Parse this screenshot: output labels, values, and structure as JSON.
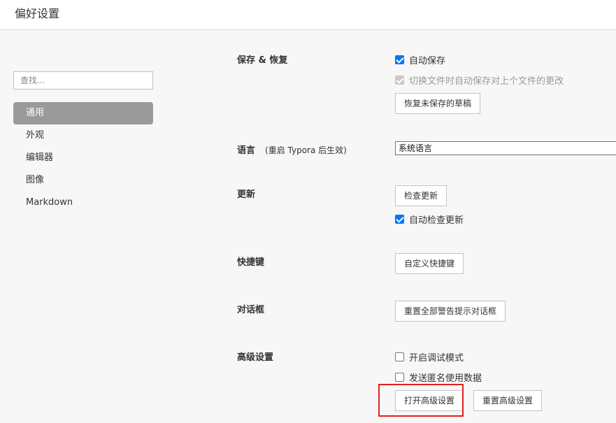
{
  "window": {
    "title": "偏好设置"
  },
  "sidebar": {
    "search_placeholder": "查找...",
    "items": [
      {
        "label": "通用",
        "active": true
      },
      {
        "label": "外观",
        "active": false
      },
      {
        "label": "编辑器",
        "active": false
      },
      {
        "label": "图像",
        "active": false
      },
      {
        "label": "Markdown",
        "active": false
      }
    ]
  },
  "sections": {
    "save_restore": {
      "label": "保存 & 恢复",
      "auto_save": {
        "label": "自动保存",
        "checked": true
      },
      "auto_save_on_switch": {
        "label": "切换文件时自动保存对上个文件的更改",
        "checked": true,
        "disabled": true
      },
      "restore_button": "恢复未保存的草稿"
    },
    "language": {
      "label": "语言",
      "note": "(重启 Typora 后生效)",
      "selected": "系统语言"
    },
    "update": {
      "label": "更新",
      "check_button": "检查更新",
      "auto_check": {
        "label": "自动检查更新",
        "checked": true
      }
    },
    "shortcuts": {
      "label": "快捷键",
      "custom_button": "自定义快捷键"
    },
    "dialogs": {
      "label": "对话框",
      "reset_button": "重置全部警告提示对话框"
    },
    "advanced": {
      "label": "高级设置",
      "debug_mode": {
        "label": "开启调试模式",
        "checked": false
      },
      "send_usage": {
        "label": "发送匿名使用数据",
        "checked": false
      },
      "open_button": "打开高级设置",
      "reset_button": "重置高级设置"
    }
  },
  "colors": {
    "accent": "#0075ff",
    "active_nav": "#9a9a9a",
    "highlight": "#e02020"
  }
}
